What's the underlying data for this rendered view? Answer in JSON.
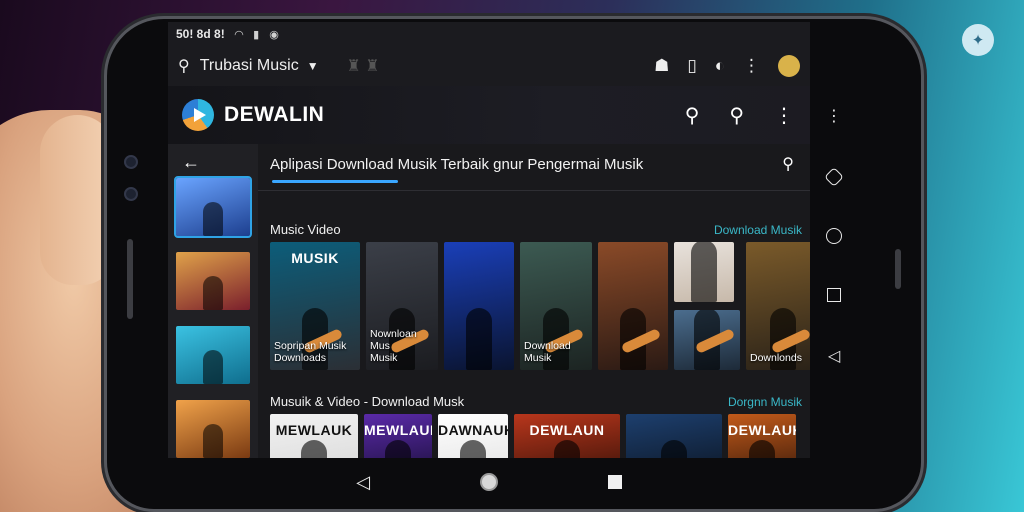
{
  "status_bar": {
    "time": "50! 8d 8! ",
    "icons": [
      "wifi-icon",
      "signal-icon",
      "battery-icon"
    ]
  },
  "top_bar": {
    "title": "Trubasi Music",
    "icons": [
      "notification-icon",
      "phone-icon",
      "chat-icon",
      "more-icon",
      "avatar"
    ]
  },
  "app_bar": {
    "brand": "DEWALIN",
    "icons": [
      "search-icon",
      "search-icon",
      "more-icon"
    ]
  },
  "sidebar": {
    "thumbnails": [
      {
        "colors": [
          "#1d3f8f",
          "#6aa4ff"
        ],
        "selected": true
      },
      {
        "colors": [
          "#7a1f2c",
          "#e0a24a"
        ],
        "selected": false
      },
      {
        "colors": [
          "#0f6e8e",
          "#3bc2e2"
        ],
        "selected": false
      },
      {
        "colors": [
          "#7a3a12",
          "#f0a24a"
        ],
        "selected": false
      }
    ]
  },
  "content": {
    "page_title": "Aplipasi Download Musik Terbaik gnur Pengermai Musik",
    "sections": [
      {
        "title": "Music Video",
        "link": "Download Musik",
        "cards": [
          {
            "label": "Sopripan Musik\nDownloads",
            "banner": "MUSIK",
            "colors": [
              "#0c5d7a",
              "#2b2f35"
            ],
            "guitar": true
          },
          {
            "label": "Nownloan Mus\nMusik",
            "banner": "",
            "colors": [
              "#3b3f48",
              "#1b1c20"
            ],
            "guitar": true
          },
          {
            "label": "",
            "banner": "",
            "colors": [
              "#1a3fb8",
              "#0a1430"
            ],
            "guitar": false
          },
          {
            "label": "Download\nMusik",
            "banner": "",
            "colors": [
              "#3c5a52",
              "#1c2422"
            ],
            "guitar": true
          },
          {
            "label": "",
            "banner": "",
            "colors": [
              "#8a4a28",
              "#2b1a14"
            ],
            "guitar": true
          },
          {
            "label": "",
            "banner": "",
            "colors": [
              "#e8e2dc",
              "#c7b9aa"
            ],
            "guitar": false
          },
          {
            "label": "",
            "banner": "",
            "colors": [
              "#4b6d8e",
              "#1d2a38"
            ],
            "guitar": true
          },
          {
            "label": "Downlonds",
            "banner": "",
            "colors": [
              "#7a5a2a",
              "#2a2218"
            ],
            "guitar": true
          }
        ]
      },
      {
        "title": "Musuik & Video - Download Musk",
        "link": "Dorgnn Musik",
        "cards": [
          {
            "banner": "MEWLAUK",
            "colors": [
              "#f2f2f2",
              "#d8d8d8"
            ],
            "banner_color": "#111"
          },
          {
            "banner": "MEWLAUK",
            "colors": [
              "#5a2aa8",
              "#1a0f3a"
            ],
            "banner_color": "#fff"
          },
          {
            "banner": "DAWNAUK",
            "colors": [
              "#ffffff",
              "#e2e2e2"
            ],
            "banner_color": "#111"
          },
          {
            "banner": "DEWLAUN",
            "colors": [
              "#b8361c",
              "#3a1208"
            ],
            "banner_color": "#fff"
          },
          {
            "banner": "",
            "colors": [
              "#1d3f6e",
              "#0c1624"
            ],
            "banner_color": "#fff"
          },
          {
            "banner": "DEWLAUK",
            "colors": [
              "#c25a1a",
              "#3a1a0a"
            ],
            "banner_color": "#fff"
          }
        ]
      }
    ]
  }
}
